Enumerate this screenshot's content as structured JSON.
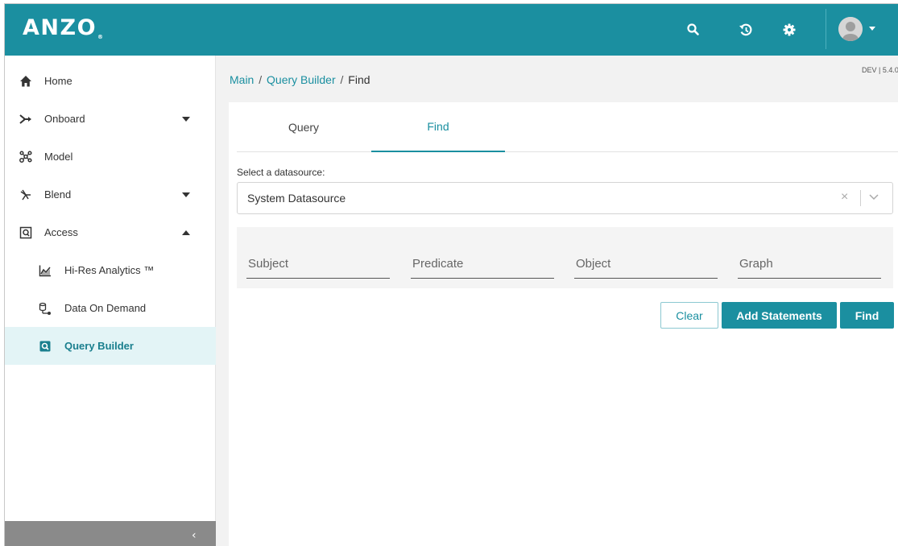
{
  "app": {
    "logo": "ANZO",
    "logo_mark": "®"
  },
  "topbar": {
    "icons": [
      "search-icon",
      "history-icon",
      "settings-icon"
    ],
    "accent": "#1b8fa0"
  },
  "sidebar": {
    "items": [
      {
        "label": "Home",
        "icon": "home-icon"
      },
      {
        "label": "Onboard",
        "icon": "onboard-arrow-icon",
        "caret": "down"
      },
      {
        "label": "Model",
        "icon": "model-graph-icon"
      },
      {
        "label": "Blend",
        "icon": "blend-icon",
        "caret": "down"
      },
      {
        "label": "Access",
        "icon": "access-icon",
        "caret": "up"
      },
      {
        "label": "Hi-Res Analytics ™",
        "icon": "analytics-chart-icon"
      },
      {
        "label": "Data On Demand",
        "icon": "data-on-demand-icon"
      },
      {
        "label": "Query Builder",
        "icon": "query-builder-icon",
        "active": true
      }
    ],
    "collapse_label": "‹"
  },
  "breadcrumb": {
    "main": "Main",
    "separator": "/",
    "query_builder": "Query Builder",
    "current": "Find"
  },
  "version": "DEV | 5.4.0",
  "tabs": [
    {
      "label": "Query",
      "active": false
    },
    {
      "label": "Find",
      "active": true
    }
  ],
  "datasource": {
    "label": "Select a datasource:",
    "value": "System Datasource",
    "clear": "×"
  },
  "statement": {
    "subject_placeholder": "Subject",
    "predicate_placeholder": "Predicate",
    "object_placeholder": "Object",
    "graph_placeholder": "Graph"
  },
  "buttons": {
    "clear": "Clear",
    "add_statements": "Add Statements",
    "find": "Find"
  }
}
